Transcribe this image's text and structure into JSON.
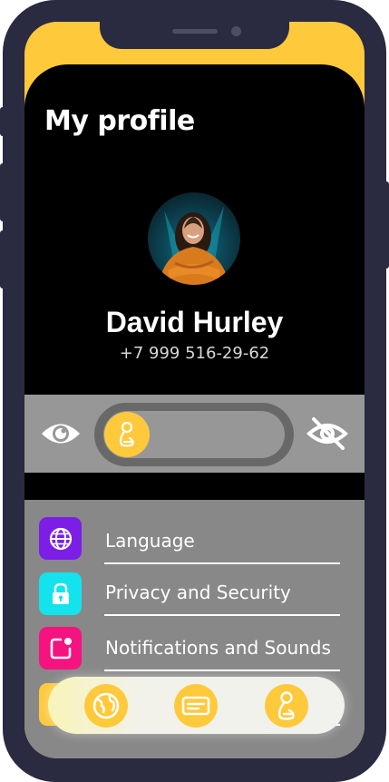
{
  "header": {
    "title": "My profile"
  },
  "profile": {
    "name": "David Hurley",
    "phone": "+7 999 516-29-62"
  },
  "visibility_toggle": {
    "state": "visible",
    "left_icon": "eye-icon",
    "right_icon": "eye-off-icon",
    "knob_icon": "person-icon"
  },
  "menu": {
    "items": [
      {
        "label": "Language",
        "icon": "globe-icon",
        "color": "#7c1ee6"
      },
      {
        "label": "Privacy and Security",
        "icon": "lock-icon",
        "color": "#14e3ee"
      },
      {
        "label": "Notifications and Sounds",
        "icon": "notification-icon",
        "color": "#f5137f"
      },
      {
        "label": "",
        "icon": "",
        "color": "#ffc93c"
      }
    ]
  },
  "bottom_nav": {
    "items": [
      {
        "icon": "globe-icon"
      },
      {
        "icon": "card-icon"
      },
      {
        "icon": "person-icon"
      }
    ]
  },
  "colors": {
    "accent": "#ffc93c",
    "frame": "#2a2a41",
    "screen_dark": "#000000",
    "toggle_band": "#979797",
    "menu_background": "#888888"
  }
}
